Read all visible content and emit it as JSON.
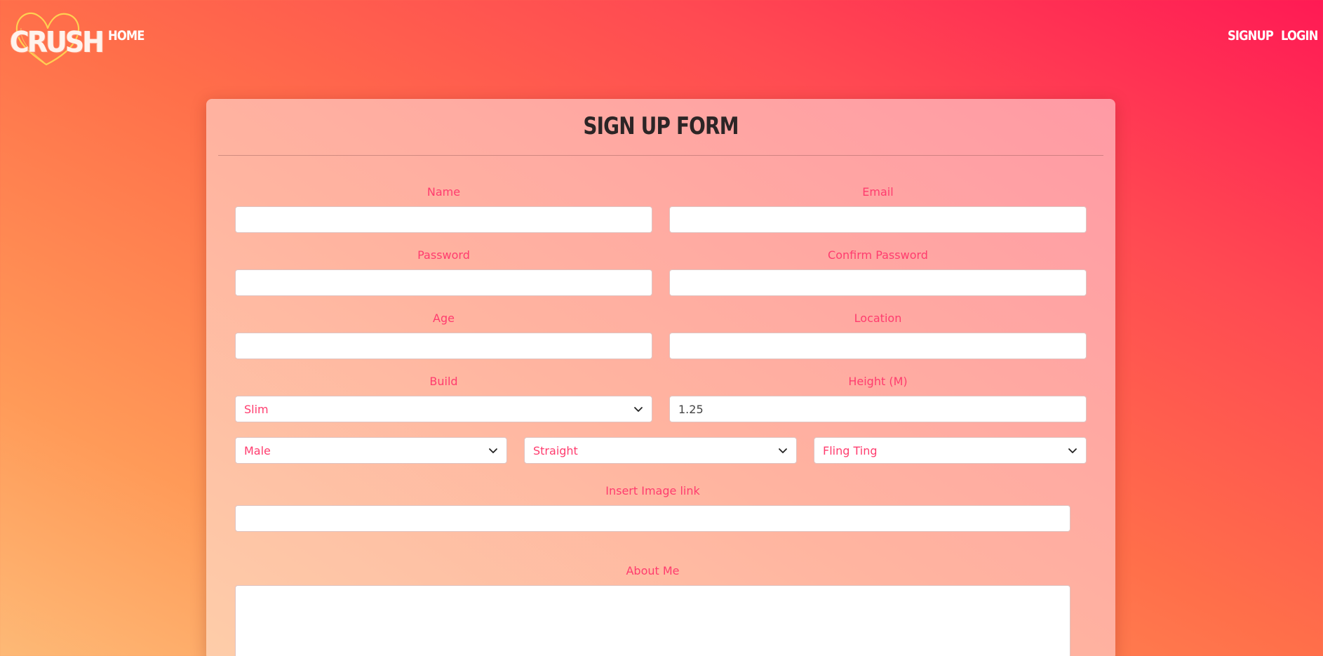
{
  "header": {
    "logo_text": "CRUSH",
    "nav_home": "HOME",
    "nav_signup": "SIGNUP",
    "nav_login": "LOGIN"
  },
  "form": {
    "title": "SIGN UP FORM",
    "name_label": "Name",
    "name_value": "",
    "email_label": "Email",
    "email_value": "",
    "password_label": "Password",
    "password_value": "",
    "confirm_password_label": "Confirm Password",
    "confirm_password_value": "",
    "age_label": "Age",
    "age_value": "",
    "location_label": "Location",
    "location_value": "",
    "build_label": "Build",
    "build_selected": "Slim",
    "height_label": "Height (M)",
    "height_value": "1.25",
    "gender_selected": "Male",
    "orientation_selected": "Straight",
    "relationship_selected": "Fling Ting",
    "image_link_label": "Insert Image link",
    "image_link_value": "",
    "about_me_label": "About Me",
    "about_me_value": ""
  },
  "colors": {
    "accent_text": "#ff3c6e",
    "title_text": "#2c2526",
    "nav_text": "#ffffff"
  },
  "icons": {
    "logo": "heart-outline-icon",
    "select_arrow": "chevron-down-icon"
  }
}
